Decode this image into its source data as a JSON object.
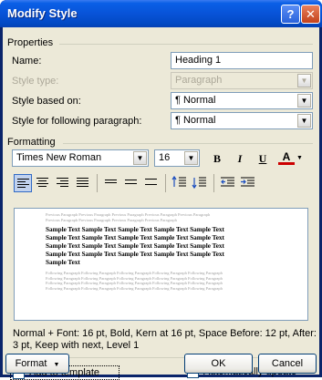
{
  "window": {
    "title": "Modify Style",
    "help_glyph": "?",
    "close_glyph": "✕"
  },
  "properties": {
    "section_label": "Properties",
    "name_label": "Name:",
    "name_value": "Heading 1",
    "style_type_label": "Style type:",
    "style_type_value": "Paragraph",
    "based_on_label": "Style based on:",
    "based_on_value": "¶ Normal",
    "following_label": "Style for following paragraph:",
    "following_value": "¶ Normal"
  },
  "formatting": {
    "section_label": "Formatting",
    "font": "Times New Roman",
    "size": "16",
    "bold_glyph": "B",
    "italic_glyph": "I",
    "underline_glyph": "U",
    "font_color_glyph": "A",
    "font_color": "#cc0000"
  },
  "preview": {
    "previous_lines": [
      "Previous Paragraph Previous Paragraph Previous Paragraph Previous Paragraph Previous Paragraph",
      "Previous Paragraph Previous Paragraph Previous Paragraph Previous Paragraph"
    ],
    "sample_lines": [
      "Sample Text Sample Text Sample Text Sample Text Sample Text",
      "Sample Text Sample Text Sample Text Sample Text Sample Text",
      "Sample Text Sample Text Sample Text Sample Text Sample Text",
      "Sample Text Sample Text Sample Text Sample Text Sample Text",
      "Sample Text"
    ],
    "following_lines": [
      "Following Paragraph Following Paragraph Following Paragraph Following Paragraph Following Paragraph",
      "Following Paragraph Following Paragraph Following Paragraph Following Paragraph Following Paragraph",
      "Following Paragraph Following Paragraph Following Paragraph Following Paragraph Following Paragraph",
      "Following Paragraph Following Paragraph Following Paragraph Following Paragraph Following Paragraph"
    ]
  },
  "description": "Normal + Font: 16 pt, Bold, Kern at 16 pt, Space Before:  12 pt, After:  3 pt, Keep with next, Level 1",
  "options": {
    "add_to_template_label": "Add to template",
    "add_to_template_checked": true,
    "auto_update_label": "Automatically update",
    "auto_update_checked": false
  },
  "buttons": {
    "format": "Format",
    "ok": "OK",
    "cancel": "Cancel"
  }
}
